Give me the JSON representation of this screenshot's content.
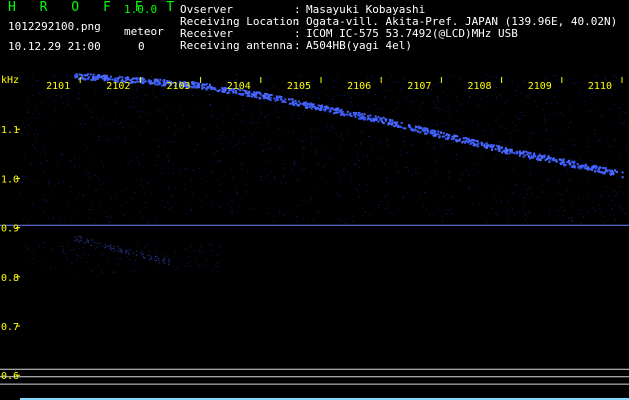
{
  "header": {
    "logo": "H R O F F T",
    "version": "1.0.0",
    "filename": "1012292100.png",
    "meteor_label": "meteor",
    "timestamp": "10.12.29 21:00",
    "meteor_count": "0"
  },
  "info": [
    {
      "key": "Ovserver",
      "value": "Masayuki Kobayashi"
    },
    {
      "key": "Receiving Location",
      "value": "Ogata-vill. Akita-Pref. JAPAN (139.96E, 40.02N)"
    },
    {
      "key": "Receiver",
      "value": "ICOM IC-575 53.7492(@LCD)MHz USB"
    },
    {
      "key": "Receiving antenna",
      "value": "A504HB(yagi 4el)"
    }
  ],
  "chart_data": {
    "type": "heatmap",
    "ylabel": "kHz",
    "x_ticks": [
      "2101",
      "2102",
      "2103",
      "2104",
      "2105",
      "2106",
      "2107",
      "2108",
      "2109",
      "2110"
    ],
    "y_ticks": [
      "1.1",
      "1.0",
      "0.9",
      "0.8",
      "0.7",
      "0.6"
    ],
    "ylim": [
      0.57,
      1.2
    ],
    "colors": {
      "background": "#000000",
      "signal": "#3a5cff",
      "axis_label": "#ffff00",
      "reference_line": "#6e80ff"
    },
    "reference_line_khz": 0.905,
    "tracks": [
      {
        "x": [
          2100.9,
          2102.0,
          2103.0,
          2104.0,
          2105.0,
          2106.0,
          2107.0,
          2108.0,
          2109.0,
          2110.0
        ],
        "y": [
          1.21,
          1.2,
          1.19,
          1.17,
          1.145,
          1.12,
          1.09,
          1.06,
          1.035,
          1.01
        ]
      },
      {
        "x": [
          2100.9,
          2101.5,
          2102.0,
          2102.5
        ],
        "y": [
          0.88,
          0.86,
          0.845,
          0.83
        ]
      }
    ]
  }
}
